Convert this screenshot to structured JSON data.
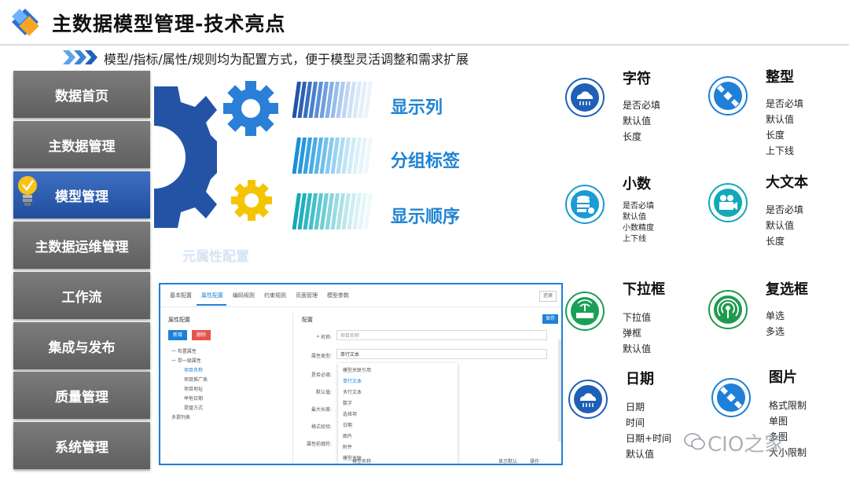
{
  "header": {
    "title": "主数据模型管理-技术亮点",
    "subtitle": "模型/指标/属性/规则均为配置方式，便于模型灵活调整和需求扩展"
  },
  "sidebar": {
    "items": [
      {
        "label": "数据首页"
      },
      {
        "label": "主数据管理"
      },
      {
        "label": "模型管理"
      },
      {
        "label": "主数据运维管理"
      },
      {
        "label": "工作流"
      },
      {
        "label": "集成与发布"
      },
      {
        "label": "质量管理"
      },
      {
        "label": "系统管理"
      }
    ],
    "active_index": 2
  },
  "features": {
    "items": [
      "显示列",
      "分组标签",
      "显示顺序"
    ],
    "meta_label": "元属性配置"
  },
  "screenshot": {
    "tabs": [
      "基本配置",
      "属性配置",
      "编码规则",
      "约束规则",
      "页面管理",
      "模型参数"
    ],
    "active_tab": 1,
    "reset_label": "还原",
    "left_title": "属性配置",
    "new_btn": "新增",
    "del_btn": "删除",
    "tree": [
      "一 布置属性",
      "一 带一级属性",
      "项目名称",
      "项目推广表",
      "项目地址",
      "举他日期",
      "提盘方式",
      "多提列表"
    ],
    "right_title": "配置",
    "save_btn": "保存",
    "fields": [
      {
        "label": "* 名称:",
        "value": "项目名称"
      },
      {
        "label": "属性类型:",
        "value": "单行文本"
      },
      {
        "label": "是否必填:",
        "value": ""
      },
      {
        "label": "默认值:",
        "value": ""
      },
      {
        "label": "最大长度:",
        "value": ""
      },
      {
        "label": "格式校验:",
        "value": ""
      },
      {
        "label": "属性前缀符:",
        "value": ""
      }
    ],
    "dropdown_options": [
      "模型关联引用",
      "单行文本",
      "多行文本",
      "数字",
      "选择项",
      "日期",
      "图片",
      "附件",
      "模型关联"
    ],
    "dropdown_selected": 1,
    "footer": [
      "模型名称",
      "显示默认",
      "操作"
    ]
  },
  "types": [
    {
      "name": "字符",
      "attrs": [
        "是否必填",
        "默认值",
        "长度"
      ],
      "icon": "cloud-icon"
    },
    {
      "name": "整型",
      "attrs": [
        "是否必填",
        "默认值",
        "长度",
        "上下线"
      ],
      "icon": "satellite-icon"
    },
    {
      "name": "小数",
      "attrs": [
        "是否必填",
        "默认值",
        "小数精度",
        "上下线"
      ],
      "icon": "database-icon"
    },
    {
      "name": "大文本",
      "attrs": [
        "是否必填",
        "默认值",
        "长度"
      ],
      "icon": "video-camera-icon"
    },
    {
      "name": "下拉框",
      "attrs": [
        "下拉值",
        "弹框",
        "默认值"
      ],
      "icon": "router-icon"
    },
    {
      "name": "复选框",
      "attrs": [
        "单选",
        "多选"
      ],
      "icon": "antenna-icon"
    },
    {
      "name": "日期",
      "attrs": [
        "日期",
        "时间",
        "日期+时间",
        "默认值"
      ],
      "icon": "cloud-icon"
    },
    {
      "name": "图片",
      "attrs": [
        "格式限制",
        "单图",
        "多图",
        "大小限制"
      ],
      "icon": "satellite-icon"
    }
  ],
  "watermark": "CIO之家",
  "colors": {
    "accent": "#1e80d8",
    "menu_gray": "#6b6b6b",
    "menu_active": "#2a5aa8",
    "gear_dark": "#2453a6",
    "gear_gold": "#f5c400"
  }
}
